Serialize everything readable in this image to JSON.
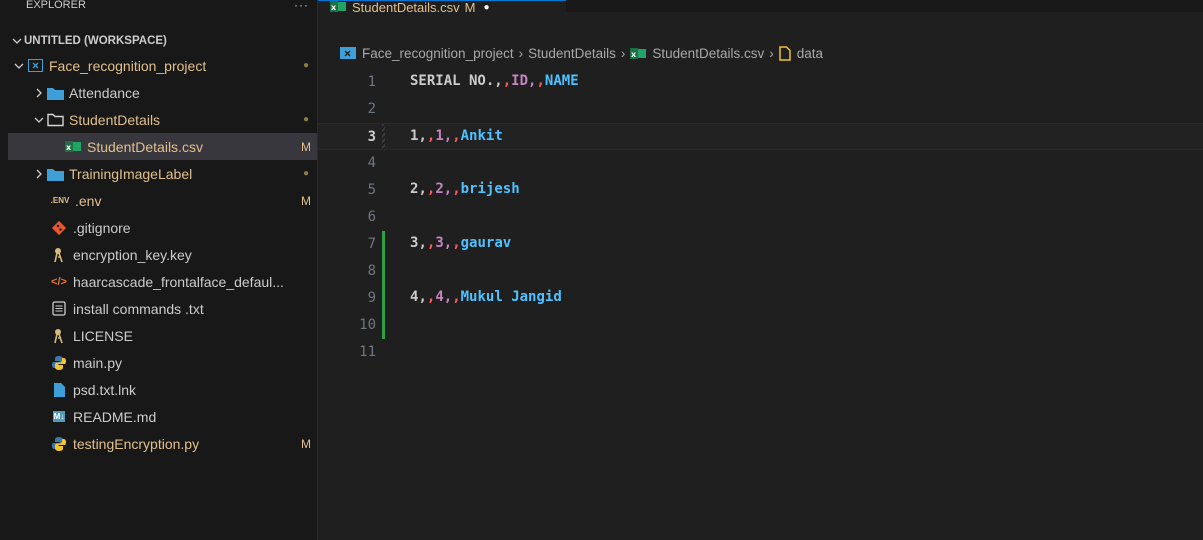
{
  "sidebar": {
    "header": "EXPLORER",
    "more": "···",
    "workspace": "UNTITLED (WORKSPACE)",
    "items": [
      {
        "label": "Face_recognition_project",
        "badge": "●"
      },
      {
        "label": "Attendance",
        "badge": ""
      },
      {
        "label": "StudentDetails",
        "badge": "●"
      },
      {
        "label": "StudentDetails.csv",
        "badge": "M"
      },
      {
        "label": "TrainingImageLabel",
        "badge": "●"
      },
      {
        "label": ".env",
        "badge": "M",
        "icon_text": ".ENV"
      },
      {
        "label": ".gitignore",
        "badge": ""
      },
      {
        "label": "encryption_key.key",
        "badge": ""
      },
      {
        "label": "haarcascade_frontalface_defaul...",
        "badge": "",
        "icon_text": "</>"
      },
      {
        "label": "install commands .txt",
        "badge": ""
      },
      {
        "label": "LICENSE",
        "badge": ""
      },
      {
        "label": "main.py",
        "badge": ""
      },
      {
        "label": "psd.txt.lnk",
        "badge": ""
      },
      {
        "label": "README.md",
        "badge": "",
        "icon_text": "M↓"
      },
      {
        "label": "testingEncryption.py",
        "badge": "M"
      }
    ]
  },
  "tab": {
    "label": "StudentDetails.csv",
    "status": "M",
    "dirty": "●"
  },
  "breadcrumb": [
    "Face_recognition_project",
    "StudentDetails",
    "StudentDetails.csv",
    "data"
  ],
  "breadcrumb_sep": "›",
  "lines": [
    {
      "num": "1",
      "cols": [
        "SERIAL NO.",
        ",",
        ",",
        "ID",
        ",",
        ",",
        "NAME"
      ]
    },
    {
      "num": "2",
      "cols": []
    },
    {
      "num": "3",
      "cols": [
        "1",
        ",",
        ",",
        "1",
        ",",
        ",",
        "Ankit"
      ]
    },
    {
      "num": "4",
      "cols": []
    },
    {
      "num": "5",
      "cols": [
        "2",
        ",",
        ",",
        "2",
        ",",
        ",",
        "brijesh"
      ]
    },
    {
      "num": "6",
      "cols": []
    },
    {
      "num": "7",
      "cols": [
        "3",
        ",",
        ",",
        "3",
        ",",
        ",",
        "gaurav"
      ]
    },
    {
      "num": "8",
      "cols": []
    },
    {
      "num": "9",
      "cols": [
        "4",
        ",",
        ",",
        "4",
        ",",
        ",",
        "Mukul Jangid"
      ]
    },
    {
      "num": "10",
      "cols": []
    },
    {
      "num": "11",
      "cols": []
    }
  ],
  "colors": {
    "accent": "#0078d4",
    "modified": "#e2c08d",
    "added_gutter": "#2ea043"
  }
}
